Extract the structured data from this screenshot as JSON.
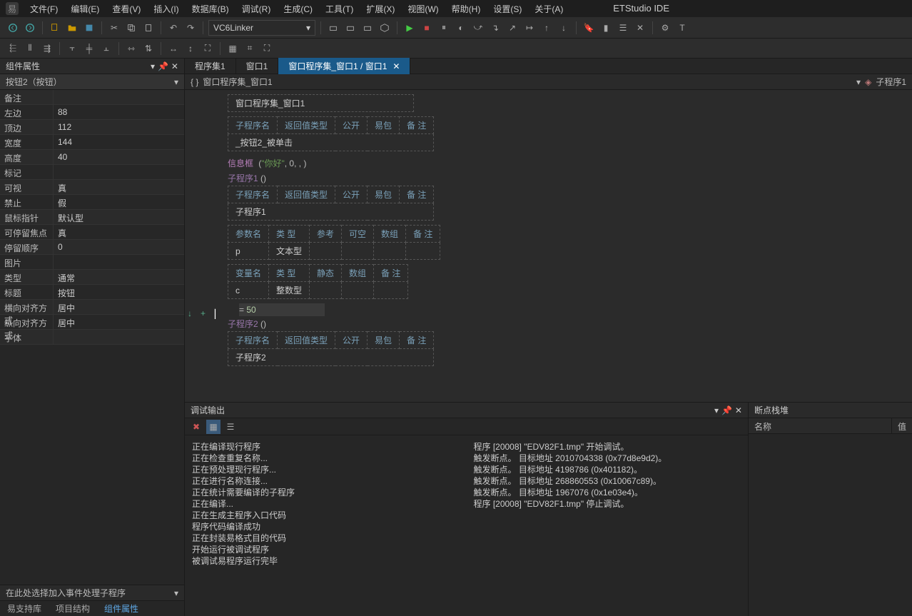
{
  "brand": "ETStudio IDE",
  "menu": [
    "文件(F)",
    "编辑(E)",
    "查看(V)",
    "插入(I)",
    "数据库(B)",
    "调试(R)",
    "生成(C)",
    "工具(T)",
    "扩展(X)",
    "视图(W)",
    "帮助(H)",
    "设置(S)",
    "关于(A)"
  ],
  "combo": "VC6Linker",
  "left": {
    "title": "组件属性",
    "selector": "按钮2（按钮）",
    "rows": [
      {
        "name": "备注",
        "val": ""
      },
      {
        "name": "左边",
        "val": "88"
      },
      {
        "name": "顶边",
        "val": "112"
      },
      {
        "name": "宽度",
        "val": "144"
      },
      {
        "name": "高度",
        "val": "40"
      },
      {
        "name": "标记",
        "val": ""
      },
      {
        "name": "可视",
        "val": "真"
      },
      {
        "name": "禁止",
        "val": "假"
      },
      {
        "name": "鼠标指针",
        "val": "默认型"
      },
      {
        "name": "可停留焦点",
        "val": "真"
      },
      {
        "name": "停留顺序",
        "val": "0"
      },
      {
        "name": "图片",
        "val": ""
      },
      {
        "name": "类型",
        "val": "通常"
      },
      {
        "name": "标题",
        "val": "按钮"
      },
      {
        "name": "横向对齐方式",
        "val": "居中"
      },
      {
        "name": "纵向对齐方式",
        "val": "居中"
      },
      {
        "name": "字体",
        "val": ""
      }
    ],
    "event_hint": "在此处选择加入事件处理子程序",
    "tabs": [
      "易支持库",
      "项目结构",
      "组件属性"
    ]
  },
  "file_tabs": [
    {
      "label": "程序集1",
      "active": false
    },
    {
      "label": "窗口1",
      "active": false
    },
    {
      "label": "窗口程序集_窗口1 / 窗口1",
      "active": true,
      "closable": true
    }
  ],
  "crumb": {
    "left": "窗口程序集_窗口1",
    "right": "子程序1"
  },
  "editor": {
    "table0": [
      [
        "窗口程序集_窗口1"
      ]
    ],
    "table1_head": [
      "子程序名",
      "返回值类型",
      "公开",
      "易包",
      "备  注"
    ],
    "table1_row": [
      "_按钮2_被单击"
    ],
    "line1_kw": "信息框",
    "line1_p1": "(",
    "line1_str": "\"你好\"",
    "line1_rest": ", 0, , )",
    "line2_fn": "子程序1",
    "line2_p": " ()",
    "table2_head": [
      "子程序名",
      "返回值类型",
      "公开",
      "易包",
      "备  注"
    ],
    "table2_row": [
      "子程序1"
    ],
    "table3_head": [
      "参数名",
      "类  型",
      "参考",
      "可空",
      "数组",
      "备  注"
    ],
    "table3_row_name": "p",
    "table3_row_type": "文本型",
    "table4_head": [
      "变量名",
      "类  型",
      "静态",
      "数组",
      "备  注"
    ],
    "table4_row_name": "c",
    "table4_row_type": "整数型",
    "line3_eq": " = ",
    "line3_val": "50",
    "line4_fn": "子程序2",
    "line4_p": " ()",
    "table5_head": [
      "子程序名",
      "返回值类型",
      "公开",
      "易包",
      "备  注"
    ],
    "table5_row": [
      "子程序2"
    ]
  },
  "debug": {
    "title": "调试输出",
    "left_lines": [
      "正在编译现行程序",
      "正在检查重复名称...",
      "正在预处理现行程序...",
      "正在进行名称连接...",
      "正在统计需要编译的子程序",
      "正在编译...",
      "正在生成主程序入口代码",
      "程序代码编译成功",
      "正在封装易格式目的代码",
      "开始运行被调试程序",
      "被调试易程序运行完毕"
    ],
    "right_lines": [
      "程序 [20008] \"EDV82F1.tmp\" 开始调试。",
      "触发断点。 目标地址 2010704338 (0x77d8e9d2)。",
      "触发断点。 目标地址 4198786 (0x401182)。",
      "触发断点。 目标地址 268860553 (0x10067c89)。",
      "触发断点。 目标地址 1967076 (0x1e03e4)。",
      "程序 [20008] \"EDV82F1.tmp\" 停止调试。"
    ]
  },
  "bp": {
    "title": "断点栈堆",
    "col1": "名称",
    "col2": "值"
  }
}
